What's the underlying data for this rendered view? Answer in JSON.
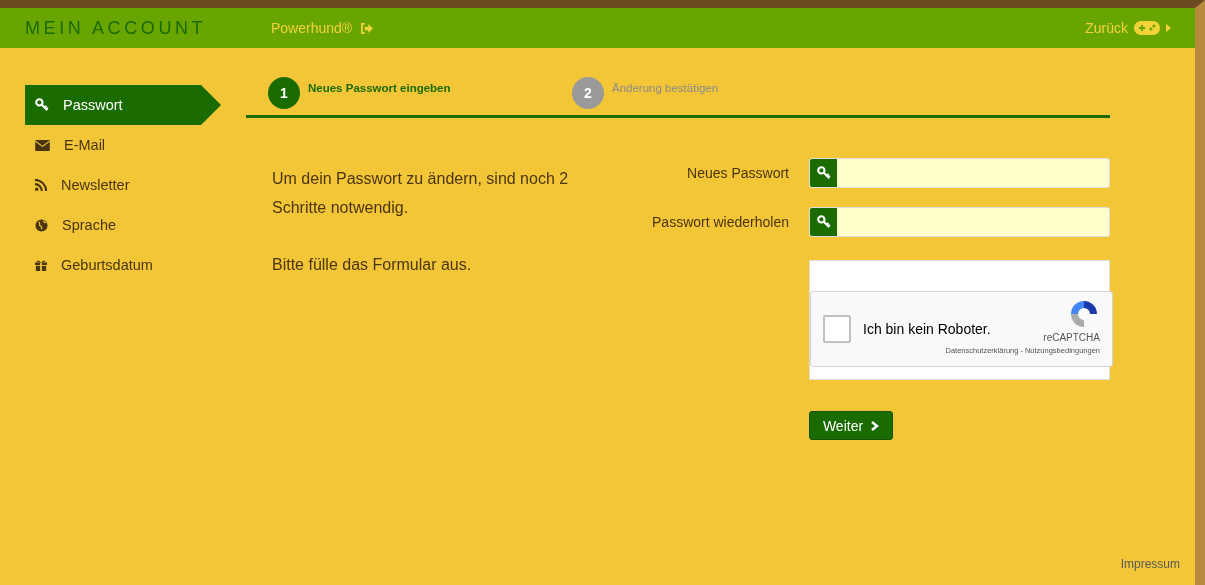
{
  "header": {
    "title": "MEIN ACCOUNT",
    "user_link": "Powerhund®",
    "back_link": "Zurück"
  },
  "sidebar": {
    "items": [
      {
        "label": "Passwort",
        "kind": "key",
        "selected": true
      },
      {
        "label": "E-Mail",
        "kind": "mail",
        "selected": false
      },
      {
        "label": "Newsletter",
        "kind": "rss",
        "selected": false
      },
      {
        "label": "Sprache",
        "kind": "globe",
        "selected": false
      },
      {
        "label": "Geburtsdatum",
        "kind": "gift",
        "selected": false
      }
    ]
  },
  "steps": [
    {
      "number": "1",
      "label": "Neues Passwort eingeben",
      "selected": true
    },
    {
      "number": "2",
      "label": "Änderung bestätigen",
      "selected": false
    }
  ],
  "intro": [
    "Um dein Passwort zu ändern, sind noch 2 Schritte notwendig.",
    "Bitte fülle das Formular aus."
  ],
  "form": {
    "fields": [
      {
        "label": "Neues Passwort"
      },
      {
        "label": "Passwort wiederholen"
      }
    ],
    "captcha": {
      "label": "Ich bin kein Roboter.",
      "checked": false,
      "brand": "reCAPTCHA",
      "privacy": "Datenschutzerklärung",
      "separator": "-",
      "terms": "Nutzungsbedingungen"
    },
    "submit": "Weiter"
  },
  "footer": {
    "link": "Impressum"
  }
}
